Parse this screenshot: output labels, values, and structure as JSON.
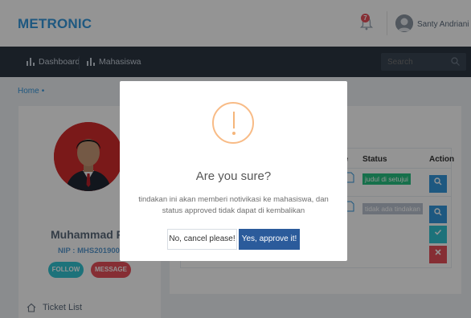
{
  "header": {
    "brand": "METRONIC",
    "notification_count": "7",
    "user_name": "Santy Andriani"
  },
  "nav": {
    "items": [
      {
        "label": "Dashboard",
        "icon": "bar-chart-icon"
      },
      {
        "label": "Mahasiswa",
        "icon": "bar-chart-icon"
      }
    ],
    "search_placeholder": "Search"
  },
  "breadcrumb": {
    "home": "Home",
    "separator": "•"
  },
  "profile": {
    "name": "Muhammad Ris",
    "nip": "NIP : MHS2019003",
    "follow_label": "FOLLOW",
    "message_label": "MESSAGE",
    "ticket_list_label": "Ticket List"
  },
  "table": {
    "columns": {
      "file_partial": "le",
      "status": "Status",
      "action": "Action"
    },
    "rows": [
      {
        "status": "judul di setujui",
        "status_color": "#26c281"
      },
      {
        "status": "tidak ada tindakan",
        "status_color": "#bac3d0"
      }
    ]
  },
  "modal": {
    "title": "Are you sure?",
    "text": "tindakan ini akan memberi notivikasi ke mahasiswa, dan status approved tidak dapat di kembalikan",
    "cancel_label": "No, cancel please!",
    "confirm_label": "Yes, approve it!",
    "icon": "warning-icon"
  },
  "colors": {
    "brand": "#3598dc",
    "nav_bg": "#2b3643",
    "confirm": "#2b5b9b",
    "warning": "#f8bb86"
  }
}
